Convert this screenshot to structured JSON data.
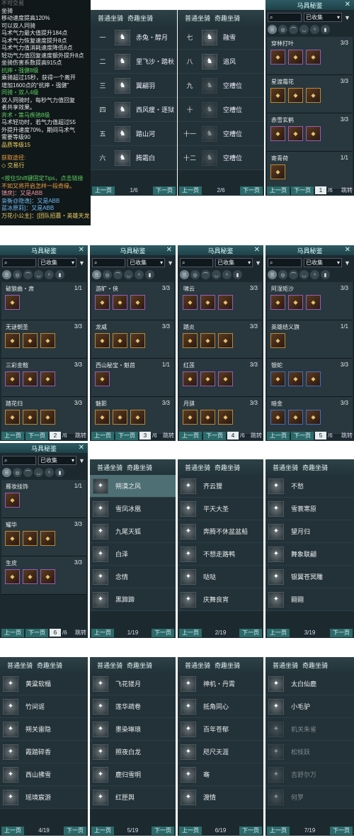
{
  "tooltip": {
    "lines": [
      {
        "t": "不可交易",
        "c": "dim"
      },
      {
        "t": "坐骑",
        "c": ""
      },
      {
        "t": "移动速度提高120%",
        "c": ""
      },
      {
        "t": "可以双人同骑",
        "c": ""
      },
      {
        "t": "马术气力最大值提升184点",
        "c": ""
      },
      {
        "t": "马术气力恢复速度提升8点",
        "c": ""
      },
      {
        "t": "马术气力值消耗速度降低8点",
        "c": ""
      },
      {
        "t": "轻功气力值回复速度额外提升8点",
        "c": ""
      },
      {
        "t": "坐骑伤害系数提高915点",
        "c": ""
      },
      {
        "t": "抗摔・强健8级",
        "c": "g"
      },
      {
        "t": "乘骑超过15秒，获得一个离开",
        "c": ""
      },
      {
        "t": "增加1600点的“抗摔・强健”",
        "c": ""
      },
      {
        "t": "同骑・双人4级",
        "c": "g"
      },
      {
        "t": "双人同骑时，每秒气力值回复",
        "c": ""
      },
      {
        "t": "者共享效果。",
        "c": ""
      },
      {
        "t": "奔术・策马疾驰8级",
        "c": "g"
      },
      {
        "t": "马术轻功时，若气力值超过55",
        "c": ""
      },
      {
        "t": "外提升速度70%，期间马术气",
        "c": ""
      },
      {
        "t": "需要等级90",
        "c": ""
      },
      {
        "t": "品质等级15",
        "c": "y"
      },
      {
        "t": "",
        "c": ""
      },
      {
        "t": "获取途径:",
        "c": "o"
      },
      {
        "t": "◇ 交易行",
        "c": "y"
      },
      {
        "t": "",
        "c": ""
      },
      {
        "t": "<按住Shift键固定Tips，点击链接",
        "c": "g"
      },
      {
        "t": "不如又将开启怎样一段奇缘。",
        "c": "o"
      },
      {
        "t": "镇戾]：又是ABB",
        "c": "p"
      },
      {
        "t": "枭衡@隐逸]：又是ABB",
        "c": "b"
      },
      {
        "t": "蓝冰原莉]：又是ABB",
        "c": "b"
      },
      {
        "t": "万花小公主]：[团队招募・英雄天龙",
        "c": "y"
      }
    ]
  },
  "p1": {
    "tab1": "普通坐骑",
    "tab2": "奇趣坐骑",
    "rows": [
      {
        "n": "一",
        "name": "赤兔・醇月"
      },
      {
        "n": "二",
        "name": "里飞沙・踏秋"
      },
      {
        "n": "三",
        "name": "翼翩羽"
      },
      {
        "n": "四",
        "name": "西风瘦・逐狱"
      },
      {
        "n": "五",
        "name": "踏山河"
      },
      {
        "n": "六",
        "name": "腾霜白"
      }
    ],
    "prev": "上一页",
    "page": "1/6",
    "next": "下一页"
  },
  "p2": {
    "tab1": "普通坐骑",
    "tab2": "奇趣坐骑",
    "rows": [
      {
        "n": "七",
        "name": "融雪"
      },
      {
        "n": "八",
        "name": "追风"
      },
      {
        "n": "九",
        "name": "空槽位"
      },
      {
        "n": "十",
        "name": "空槽位"
      },
      {
        "n": "十一",
        "name": "空槽位"
      },
      {
        "n": "十二",
        "name": "空槽位"
      }
    ],
    "prev": "上一页",
    "page": "2/6",
    "next": "下一页"
  },
  "sets": [
    {
      "title": "马具秘鉴",
      "filter": "已收集",
      "items": [
        {
          "name": "穿林打叶",
          "count": "3/3",
          "slots": 3
        },
        {
          "name": "星渡霜花",
          "count": "3/3",
          "slots": 3
        },
        {
          "name": "赤雪玄鹤",
          "count": "3/3",
          "slots": 3
        },
        {
          "name": "寄青荷",
          "count": "1/1",
          "slots": 1
        }
      ],
      "prev": "上一页",
      "pagebox": "1",
      "total": "/6",
      "next": "下一页",
      "jump": "跳转"
    },
    {
      "title": "马具秘鉴",
      "filter": "已收集",
      "items": [
        {
          "name": "破狼曲・肃",
          "count": "1/1",
          "slots": 1
        },
        {
          "name": "无谜朝圣",
          "count": "3/3",
          "slots": 3
        },
        {
          "name": "三彩金鞍",
          "count": "3/3",
          "slots": 3
        },
        {
          "name": "踏花归",
          "count": "3/3",
          "slots": 3
        }
      ],
      "prev": "上一页",
      "pagebox": "2",
      "total": "/6",
      "next": "下一页",
      "jump": "跳转"
    },
    {
      "title": "马具秘鉴",
      "filter": "已收集",
      "items": [
        {
          "name": "游旷・侠",
          "count": "3/3",
          "slots": 3
        },
        {
          "name": "龙威",
          "count": "3/3",
          "slots": 3
        },
        {
          "name": "西山秘宝・魁首",
          "count": "1/1",
          "slots": 1
        },
        {
          "name": "魅影",
          "count": "3/3",
          "slots": 3
        }
      ],
      "prev": "上一页",
      "pagebox": "3",
      "total": "/6",
      "next": "下一页",
      "jump": "跳转"
    },
    {
      "title": "马具秘鉴",
      "filter": "已收集",
      "items": [
        {
          "name": "啸云",
          "count": "3/3",
          "slots": 3
        },
        {
          "name": "踏炎",
          "count": "3/3",
          "slots": 3
        },
        {
          "name": "红莲",
          "count": "3/3",
          "slots": 3
        },
        {
          "name": "月骐",
          "count": "3/3",
          "slots": 3
        }
      ],
      "prev": "上一页",
      "pagebox": "4",
      "total": "/6",
      "next": "下一页",
      "jump": "跳转"
    },
    {
      "title": "马具秘鉴",
      "filter": "已收集",
      "items": [
        {
          "name": "阿湿矩沙",
          "count": "3/3",
          "slots": 3
        },
        {
          "name": "英雄结义旗",
          "count": "1/1",
          "slots": 1
        },
        {
          "name": "银蛇",
          "count": "3/3",
          "slots": 3
        },
        {
          "name": "暗金",
          "count": "3/3",
          "slots": 3
        }
      ],
      "prev": "上一页",
      "pagebox": "5",
      "total": "/6",
      "next": "下一页",
      "jump": "跳转"
    },
    {
      "title": "马具秘鉴",
      "filter": "已收集",
      "items": [
        {
          "name": "雁妆挂饰",
          "count": "1/1",
          "slots": 1
        },
        {
          "name": "耀华",
          "count": "3/3",
          "slots": 3
        },
        {
          "name": "生皮",
          "count": "3/3",
          "slots": 3
        }
      ],
      "prev": "上一页",
      "pagebox": "6",
      "total": "/6",
      "next": "下一页",
      "jump": "跳转"
    }
  ],
  "qi": [
    {
      "tab1": "普通坐骑",
      "tab2": "奇趣坐骑",
      "rows": [
        "朔漠之风",
        "雪凤冰凰",
        "九尾天狐",
        "白泽",
        "念情",
        "黑蹄蹄"
      ],
      "prev": "上一页",
      "page": "1/19",
      "next": "下一页"
    },
    {
      "tab1": "普通坐骑",
      "tab2": "奇趣坐骑",
      "rows": [
        "齐云狸",
        "平天大圣",
        "奔腾不休盆盆船",
        "不想走路鸭",
        "哒哒",
        "庆舞良宵"
      ],
      "prev": "上一页",
      "page": "2/19",
      "next": "下一页"
    },
    {
      "tab1": "普通坐骑",
      "tab2": "奇趣坐骑",
      "rows": [
        "不愁",
        "雪蓑寒原",
        "望月归",
        "舞象联翩",
        "银翼苍冥雕",
        "翾翾"
      ],
      "prev": "上一页",
      "page": "3/19",
      "next": "下一页"
    },
    {
      "tab1": "普通坐骑",
      "tab2": "奇趣坐骑",
      "rows": [
        "黄粱软榻",
        "竹间谣",
        "朔关雷隐",
        "霞踏碎香",
        "西山拂雪",
        "瑶境宸游"
      ],
      "prev": "上一页",
      "page": "4/19",
      "next": "下一页"
    },
    {
      "tab1": "普通坐骑",
      "tab2": "奇趣坐骑",
      "rows": [
        "飞花镂月",
        "莲华疏卷",
        "墨染琳琅",
        "照夜白龙",
        "鹿归雪明",
        "红匣舆"
      ],
      "prev": "上一页",
      "page": "5/19",
      "next": "下一页"
    },
    {
      "tab1": "普通坐骑",
      "tab2": "奇趣坐骑",
      "rows": [
        "神机・丹霄",
        "抵角同心",
        "百年苍郁",
        "咫尺天涯",
        "骞",
        "渡情"
      ],
      "prev": "上一页",
      "page": "6/19",
      "next": "下一页"
    },
    {
      "tab1": "普通坐骑",
      "tab2": "奇趣坐骑",
      "rows": [
        "太白仙鹿",
        "小毛驴",
        "机关朱雀",
        "松枝跃",
        "吉舒尔万",
        "何罗"
      ],
      "prev": "上一页",
      "page": "7/19",
      "next": "下一页"
    }
  ]
}
